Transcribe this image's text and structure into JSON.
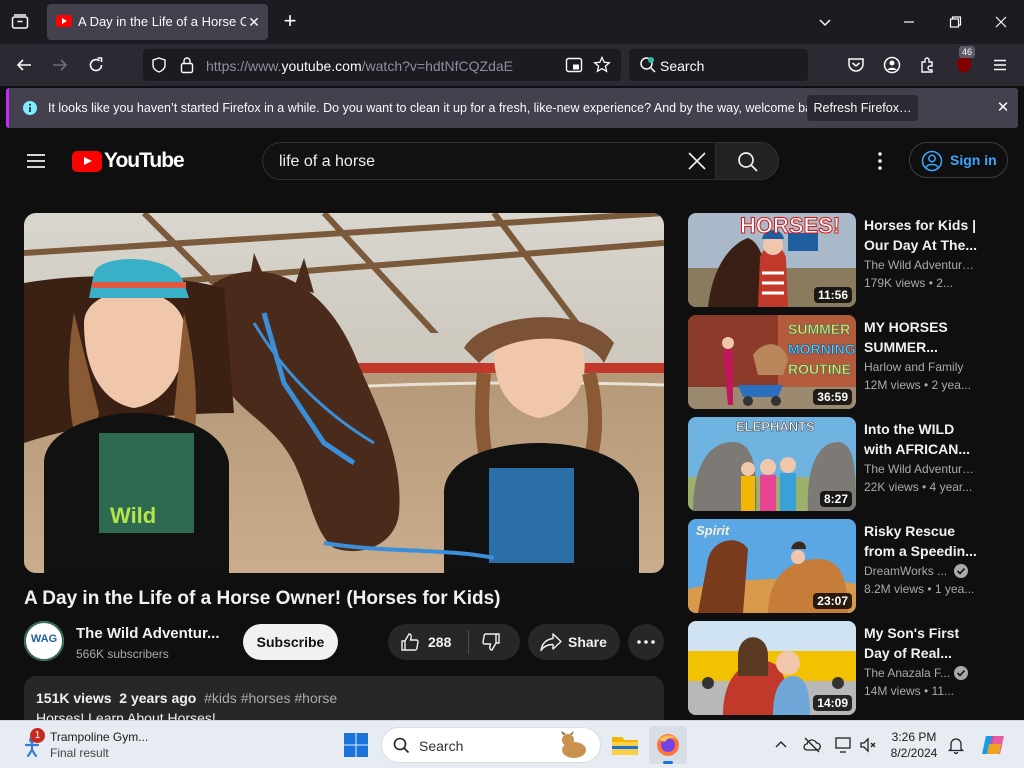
{
  "browser": {
    "tab": {
      "title": "A Day in the Life of a Horse Owner! (Horses for Kids) - YouTube"
    },
    "url": {
      "prefix": "https://www.",
      "domain": "youtube.com",
      "path": "/watch?v=hdtNfCQZdaE"
    },
    "search_placeholder": "Search",
    "extension_badge": "46",
    "notification": {
      "message": "It looks like you haven’t started Firefox in a while. Do you want to clean it up for a fresh, like-new experience? And by the way, welcome back!",
      "button": "Refresh Firefox…"
    }
  },
  "youtube": {
    "logo_text": "YouTube",
    "search_query": "life of a horse",
    "signin_label": "Sign in",
    "video": {
      "title": "A Day in the Life of a Horse Owner! (Horses for Kids)",
      "channel": "The Wild Adventures",
      "channel_display": "The Wild Adventur...",
      "avatar_text": "WAG",
      "subscribers": "566K subscribers",
      "subscribe_label": "Subscribe",
      "likes": "288",
      "share_label": "Share",
      "views": "151K views",
      "age": "2 years ago",
      "tags": "#kids #horses #horse",
      "description_start": "Horses! Learn About Horses!"
    },
    "recommendations": [
      {
        "title": "Horses for Kids | Our Day At The...",
        "channel": "The Wild Adventure...",
        "meta": "179K views • 2...",
        "duration": "11:56",
        "verified": false,
        "thumb_text": "HORSES!"
      },
      {
        "title": "MY HORSES SUMMER...",
        "channel": "Harlow and Family",
        "meta": "12M views • 2 yea...",
        "duration": "36:59",
        "verified": false,
        "thumb_text": [
          "SUMMER",
          "MORNING",
          "ROUTINE"
        ]
      },
      {
        "title": "Into the WILD with AFRICAN...",
        "channel": "The Wild Adventure...",
        "meta": "22K views • 4 year...",
        "duration": "8:27",
        "verified": false,
        "thumb_text": "ELEPHANTS"
      },
      {
        "title": "Risky Rescue from a Speedin...",
        "channel": "DreamWorks ...",
        "meta": "8.2M views • 1 yea...",
        "duration": "23:07",
        "verified": true,
        "thumb_text": "Spirit"
      },
      {
        "title": "My Son's First Day of Real...",
        "channel": "The Anazala F...",
        "meta": "14M views • 11...",
        "duration": "14:09",
        "verified": true,
        "thumb_text": ""
      }
    ]
  },
  "taskbar": {
    "widget_title": "Trampoline Gym...",
    "widget_subtitle": "Final result",
    "widget_badge": "1",
    "search_placeholder": "Search",
    "time": "3:26 PM",
    "date": "8/2/2024"
  },
  "colors": {
    "youtube_red": "#ff0000",
    "link_blue": "#3ea6ff",
    "firefox_accent": "#c42bff"
  }
}
